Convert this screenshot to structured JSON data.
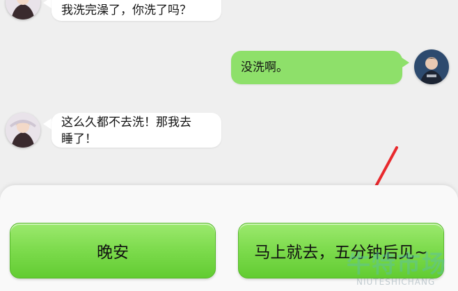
{
  "messages": [
    {
      "side": "left",
      "text": "我洗完澡了，你洗了吗？"
    },
    {
      "side": "right",
      "text": "没洗啊。"
    },
    {
      "side": "left",
      "text_line1": "这么久都不去洗！那我去",
      "text_line2": "睡了！"
    }
  ],
  "choices": {
    "left_label": "晚安",
    "right_label": "马上就去，五分钟后见~"
  },
  "watermark": {
    "main": "牛特市场",
    "sub": "NIUTESHICHANG"
  },
  "colors": {
    "bubble_green": "#8ee06a",
    "button_green": "#7fdc4f",
    "arrow_red": "#e8292d"
  }
}
